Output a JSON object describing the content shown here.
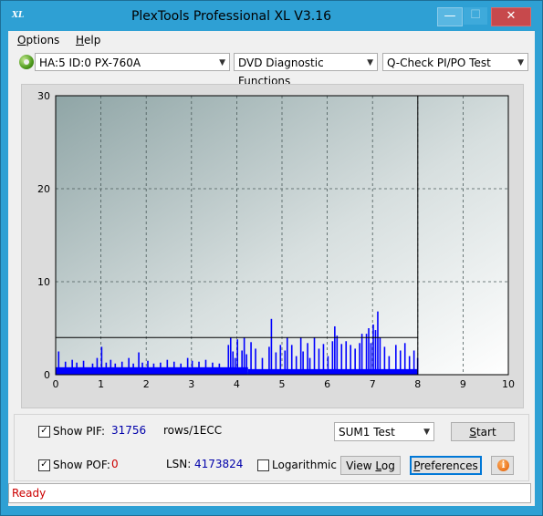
{
  "window": {
    "title": "PlexTools Professional XL V3.16",
    "icon": "XL",
    "controls": {
      "minimize": "—",
      "maximize": "☐",
      "close": "✕"
    }
  },
  "menu": [
    {
      "label": "Options",
      "underline": "O"
    },
    {
      "label": "Help",
      "underline": "H"
    }
  ],
  "toolbar": {
    "drive": "HA:5 ID:0  PX-760A",
    "function": "DVD Diagnostic Functions",
    "test": "Q-Check PI/PO Test"
  },
  "chart_data": {
    "type": "bar",
    "xlabel": "",
    "ylabel": "",
    "xlim": [
      0,
      10
    ],
    "ylim": [
      0,
      30
    ],
    "x_ticks": [
      "0",
      "1",
      "2",
      "3",
      "4",
      "5",
      "6",
      "7",
      "8",
      "9",
      "10"
    ],
    "y_ticks": [
      "0",
      "10",
      "20",
      "30"
    ],
    "grid": true,
    "threshold_line": 4,
    "end_marker_x": 8,
    "series": [
      {
        "color": "#0000ff",
        "baseline_segments": [
          [
            0,
            4.25,
            0.8
          ],
          [
            4.25,
            8,
            0.6
          ]
        ],
        "spikes": [
          [
            0.05,
            2.5
          ],
          [
            0.2,
            1.4
          ],
          [
            0.35,
            1.6
          ],
          [
            0.45,
            1.3
          ],
          [
            0.6,
            1.5
          ],
          [
            0.8,
            1.2
          ],
          [
            0.9,
            1.8
          ],
          [
            1.0,
            3.0
          ],
          [
            1.1,
            1.3
          ],
          [
            1.2,
            1.6
          ],
          [
            1.3,
            1.2
          ],
          [
            1.45,
            1.4
          ],
          [
            1.6,
            1.8
          ],
          [
            1.7,
            1.2
          ],
          [
            1.82,
            2.4
          ],
          [
            1.9,
            1.3
          ],
          [
            2.02,
            1.5
          ],
          [
            2.15,
            1.2
          ],
          [
            2.3,
            1.3
          ],
          [
            2.45,
            1.6
          ],
          [
            2.6,
            1.4
          ],
          [
            2.75,
            1.2
          ],
          [
            2.9,
            1.8
          ],
          [
            3.0,
            1.5
          ],
          [
            3.15,
            1.4
          ],
          [
            3.3,
            1.6
          ],
          [
            3.45,
            1.3
          ],
          [
            3.6,
            1.2
          ],
          [
            3.8,
            3.2
          ],
          [
            3.85,
            4.0
          ],
          [
            3.9,
            2.5
          ],
          [
            3.95,
            1.8
          ],
          [
            4.0,
            3.8
          ],
          [
            4.1,
            2.6
          ],
          [
            4.15,
            4.0
          ],
          [
            4.2,
            2.2
          ],
          [
            4.3,
            3.5
          ],
          [
            4.4,
            2.8
          ],
          [
            4.55,
            1.8
          ],
          [
            4.7,
            3.0
          ],
          [
            4.75,
            6.0
          ],
          [
            4.85,
            2.4
          ],
          [
            4.95,
            3.2
          ],
          [
            5.05,
            2.6
          ],
          [
            5.1,
            4.0
          ],
          [
            5.2,
            3.2
          ],
          [
            5.3,
            2.0
          ],
          [
            5.4,
            4.0
          ],
          [
            5.45,
            2.5
          ],
          [
            5.55,
            3.4
          ],
          [
            5.6,
            1.8
          ],
          [
            5.7,
            4.0
          ],
          [
            5.8,
            2.8
          ],
          [
            5.9,
            3.3
          ],
          [
            6.0,
            2.0
          ],
          [
            6.1,
            3.6
          ],
          [
            6.15,
            5.2
          ],
          [
            6.2,
            4.2
          ],
          [
            6.3,
            3.3
          ],
          [
            6.4,
            3.6
          ],
          [
            6.5,
            3.2
          ],
          [
            6.6,
            2.8
          ],
          [
            6.7,
            3.4
          ],
          [
            6.75,
            4.4
          ],
          [
            6.85,
            4.4
          ],
          [
            6.9,
            5.0
          ],
          [
            6.95,
            3.4
          ],
          [
            7.0,
            5.4
          ],
          [
            7.05,
            4.8
          ],
          [
            7.1,
            6.8
          ],
          [
            7.15,
            4.0
          ],
          [
            7.25,
            3.0
          ],
          [
            7.35,
            2.0
          ],
          [
            7.5,
            3.2
          ],
          [
            7.6,
            2.6
          ],
          [
            7.7,
            3.4
          ],
          [
            7.8,
            2.0
          ],
          [
            7.9,
            2.6
          ],
          [
            7.98,
            1.8
          ]
        ]
      }
    ]
  },
  "controls": {
    "show_pif_label": "Show PIF:",
    "pif_value": "31756",
    "rows_label": "rows/1ECC",
    "show_pof_label": "Show POF:",
    "pof_value": "0",
    "lsn_label": "LSN:",
    "lsn_value": "4173824",
    "logarithmic_label": "Logarithmic",
    "sum_select": "SUM1 Test",
    "start_button": "Start",
    "view_log_button": "View Log",
    "preferences_button": "Preferences",
    "info_icon": "i",
    "show_pif_checked": true,
    "show_pof_checked": true,
    "logarithmic_checked": false
  },
  "status": "Ready",
  "colors": {
    "titlebar": "#2ea0d4",
    "series": "#0000ff",
    "threshold": "#000000",
    "status_text": "#cc0000"
  }
}
